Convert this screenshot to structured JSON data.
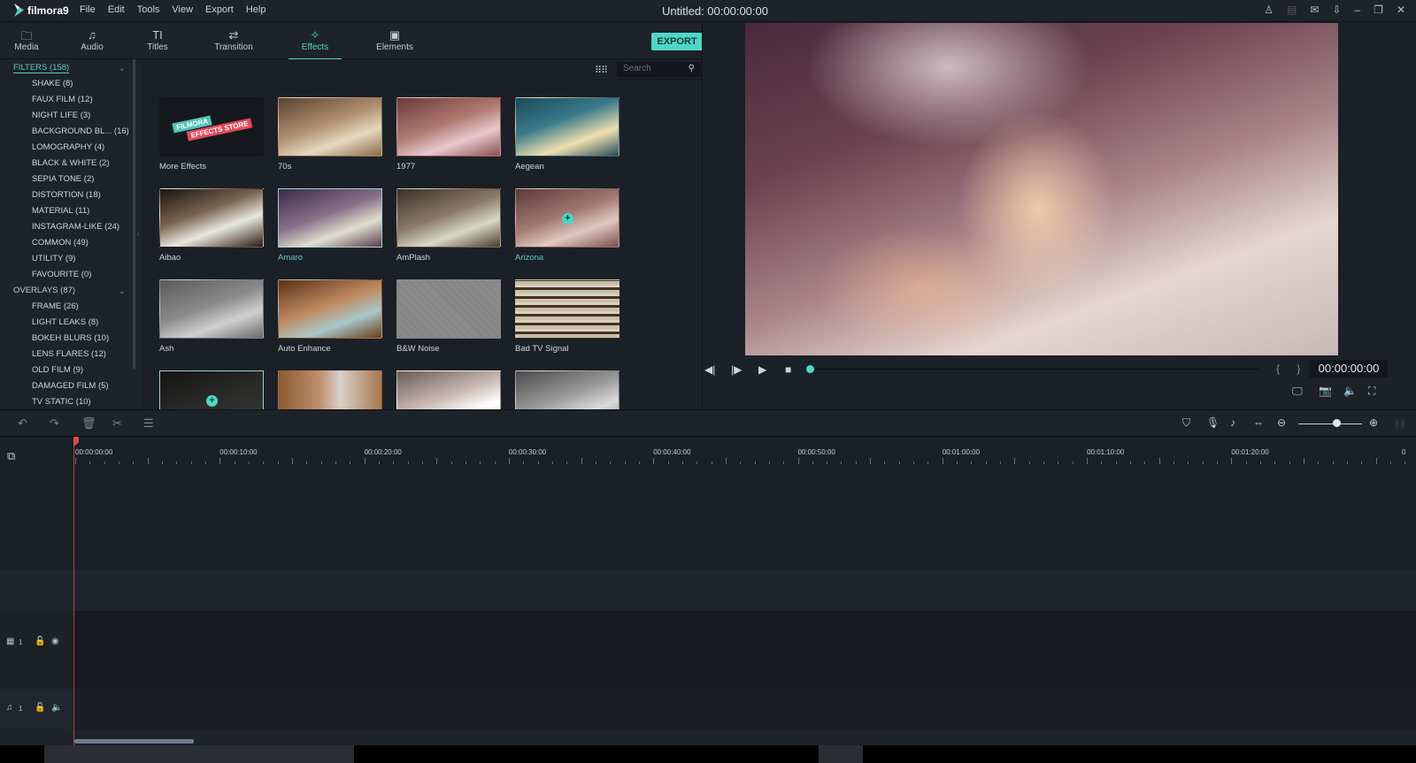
{
  "app": {
    "name": "filmora9",
    "menu": [
      "File",
      "Edit",
      "Tools",
      "View",
      "Export",
      "Help"
    ],
    "window_title": "Untitled:  00:00:00:00",
    "window_icons": [
      "account-icon",
      "save-icon",
      "mail-icon",
      "download-icon",
      "minimize-icon",
      "restore-icon",
      "close-icon"
    ]
  },
  "nav": {
    "tabs": [
      {
        "label": "Media",
        "icon": "folder-icon",
        "glyph": "🗀"
      },
      {
        "label": "Audio",
        "icon": "music-note-icon",
        "glyph": "♫"
      },
      {
        "label": "Titles",
        "icon": "titles-icon",
        "glyph": "TI"
      },
      {
        "label": "Transition",
        "icon": "transition-icon",
        "glyph": "⇄"
      },
      {
        "label": "Effects",
        "icon": "effects-icon",
        "glyph": "✧"
      },
      {
        "label": "Elements",
        "icon": "image-icon",
        "glyph": "▣"
      }
    ],
    "active": "Effects",
    "export_label": "EXPORT"
  },
  "sidebar": {
    "groups": [
      {
        "label": "FILTERS (158)",
        "active": true,
        "items": [
          "SHAKE (8)",
          "FAUX FILM (12)",
          "NIGHT LIFE (3)",
          "BACKGROUND BL... (16)",
          "LOMOGRAPHY (4)",
          "BLACK & WHITE (2)",
          "SEPIA TONE (2)",
          "DISTORTION (18)",
          "MATERIAL (11)",
          "INSTAGRAM-LIKE (24)",
          "COMMON (49)",
          "UTILITY (9)",
          "FAVOURITE (0)"
        ]
      },
      {
        "label": "OVERLAYS (87)",
        "active": false,
        "items": [
          "FRAME (26)",
          "LIGHT LEAKS (8)",
          "BOKEH BLURS (10)",
          "LENS FLARES (12)",
          "OLD FILM (9)",
          "DAMAGED FILM (5)",
          "TV STATIC (10)"
        ]
      }
    ]
  },
  "effects": {
    "search_placeholder": "Search",
    "store_banner": [
      "FILMORA",
      "EFFECTS STORE"
    ],
    "tiles": [
      {
        "name": "More Effects",
        "style": "store"
      },
      {
        "name": "70s",
        "style": "warm"
      },
      {
        "name": "1977",
        "style": "pink"
      },
      {
        "name": "Aegean",
        "style": "teal"
      },
      {
        "name": "Aibao",
        "style": "contrast"
      },
      {
        "name": "Amaro",
        "style": "purple",
        "selected": true,
        "highlight": true
      },
      {
        "name": "AmPlash",
        "style": "muted"
      },
      {
        "name": "Arizona",
        "style": "rose",
        "highlight": true,
        "add": true
      },
      {
        "name": "Ash",
        "style": "gray"
      },
      {
        "name": "Auto Enhance",
        "style": "vivid"
      },
      {
        "name": "B&W Noise",
        "style": "bwnoise"
      },
      {
        "name": "Bad TV Signal",
        "style": "glitch"
      },
      {
        "name": "",
        "style": "dark",
        "add": true,
        "selected": true
      },
      {
        "name": "",
        "style": "split"
      },
      {
        "name": "",
        "style": "bright"
      },
      {
        "name": "",
        "style": "gray2"
      }
    ]
  },
  "preview": {
    "timecode": "00:00:00:00",
    "brackets": "{ }",
    "progress": 0
  },
  "timeline": {
    "left_tools": [
      "undo-icon",
      "redo-icon",
      "delete-icon",
      "cut-icon",
      "adjust-icon"
    ],
    "right_tools": [
      "marker-icon",
      "mic-icon",
      "voiceover-icon",
      "fit-icon",
      "zoom-out-icon",
      "zoom-in-icon"
    ],
    "zoom_level": 0.6,
    "ruler_labels": [
      "00:00:00:00",
      "00:00:10:00",
      "00:00:20:00",
      "00:00:30:00",
      "00:00:40:00",
      "00:00:50:00",
      "00:01:00:00",
      "00:01:10:00",
      "00:01:20:00",
      "0"
    ],
    "video_track": {
      "number": "1"
    },
    "audio_track": {
      "number": "1"
    }
  }
}
